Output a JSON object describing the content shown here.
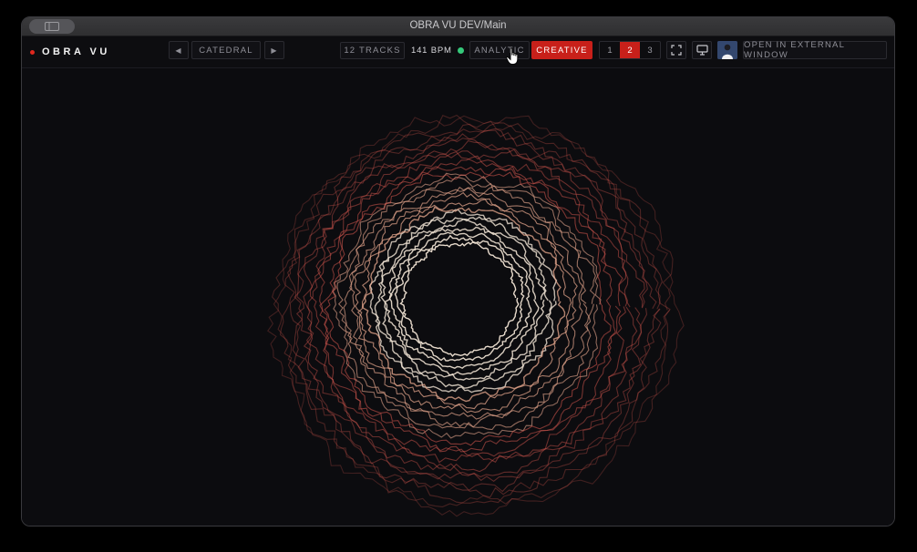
{
  "window": {
    "title": "OBRA VU DEV/Main"
  },
  "brand": {
    "name": "OBRA VU"
  },
  "nav": {
    "prev_label": "◀",
    "preset_label": "CATEDRAL",
    "next_label": "▶"
  },
  "status": {
    "tracks_label": "12 TRACKS",
    "bpm_label": "141 BPM"
  },
  "modes": {
    "analytic_label": "ANALYTIC",
    "creative_label": "CREATIVE",
    "active": "CREATIVE"
  },
  "layouts": {
    "options": [
      "1",
      "2",
      "3"
    ],
    "active": "2"
  },
  "external_label": "OPEN IN EXTERNAL WINDOW",
  "colors": {
    "accent": "#c8201a",
    "live": "#35c97a",
    "background": "#0c0c0f"
  },
  "icons": {
    "fullscreen": "fullscreen-icon",
    "display": "monitor-icon",
    "profile": "avatar"
  }
}
